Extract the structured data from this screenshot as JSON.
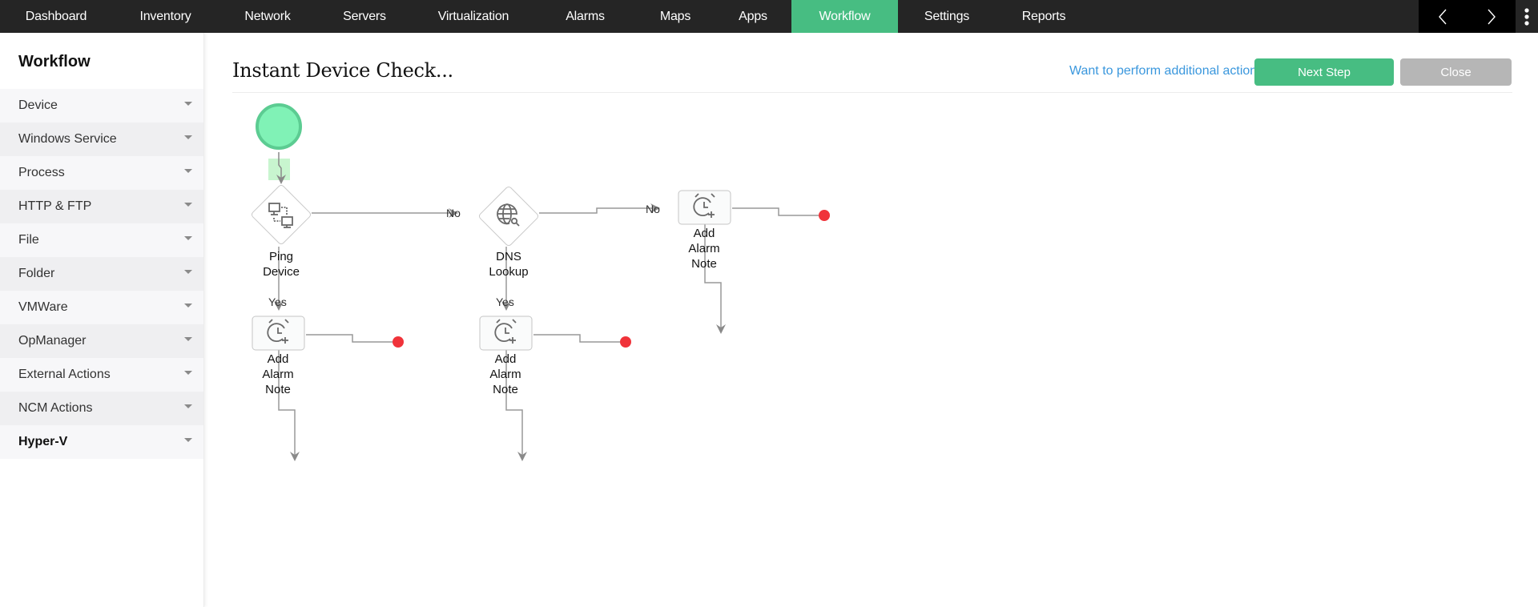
{
  "topnav": {
    "items": [
      {
        "label": "Dashboard",
        "active": false
      },
      {
        "label": "Inventory",
        "active": false
      },
      {
        "label": "Network",
        "active": false
      },
      {
        "label": "Servers",
        "active": false
      },
      {
        "label": "Virtualization",
        "active": false
      },
      {
        "label": "Alarms",
        "active": false
      },
      {
        "label": "Maps",
        "active": false
      },
      {
        "label": "Apps",
        "active": false
      },
      {
        "label": "Workflow",
        "active": true
      },
      {
        "label": "Settings",
        "active": false
      },
      {
        "label": "Reports",
        "active": false
      }
    ],
    "prev_icon": "chevron-left-icon",
    "next_icon": "chevron-right-icon",
    "more_icon": "vertical-ellipsis-icon",
    "active_color": "#47bd82"
  },
  "sidebar": {
    "title": "Workflow",
    "items": [
      {
        "label": "Device"
      },
      {
        "label": "Windows Service"
      },
      {
        "label": "Process"
      },
      {
        "label": "HTTP & FTP"
      },
      {
        "label": "File"
      },
      {
        "label": "Folder"
      },
      {
        "label": "VMWare"
      },
      {
        "label": "OpManager"
      },
      {
        "label": "External Actions"
      },
      {
        "label": "NCM Actions"
      },
      {
        "label": "Hyper-V"
      }
    ]
  },
  "header": {
    "title": "Instant Device Check...",
    "additional_actions_link": "Want to perform additional actions?",
    "next_step_label": "Next Step",
    "close_label": "Close"
  },
  "workflow": {
    "start": {
      "name": "start-node"
    },
    "nodes": {
      "ping": {
        "label": "Ping\nDevice",
        "icon": "network-devices-icon",
        "type": "condition"
      },
      "dns": {
        "label": "DNS\nLookup",
        "icon": "globe-search-icon",
        "type": "condition"
      },
      "note_ping_yes": {
        "label": "Add\nAlarm\nNote",
        "icon": "alarm-clock-plus-icon",
        "type": "action"
      },
      "note_dns_yes": {
        "label": "Add\nAlarm\nNote",
        "icon": "alarm-clock-plus-icon",
        "type": "action"
      },
      "note_dns_no": {
        "label": "Add\nAlarm\nNote",
        "icon": "alarm-clock-plus-icon",
        "type": "action"
      }
    },
    "edge_labels": {
      "ping_no": "No",
      "ping_yes": "Yes",
      "dns_no": "No",
      "dns_yes": "Yes"
    },
    "colors": {
      "start_fill": "#80f2b6",
      "start_stroke": "#5ccc92",
      "edge": "#999999",
      "end_dot": "#f0333a"
    }
  }
}
